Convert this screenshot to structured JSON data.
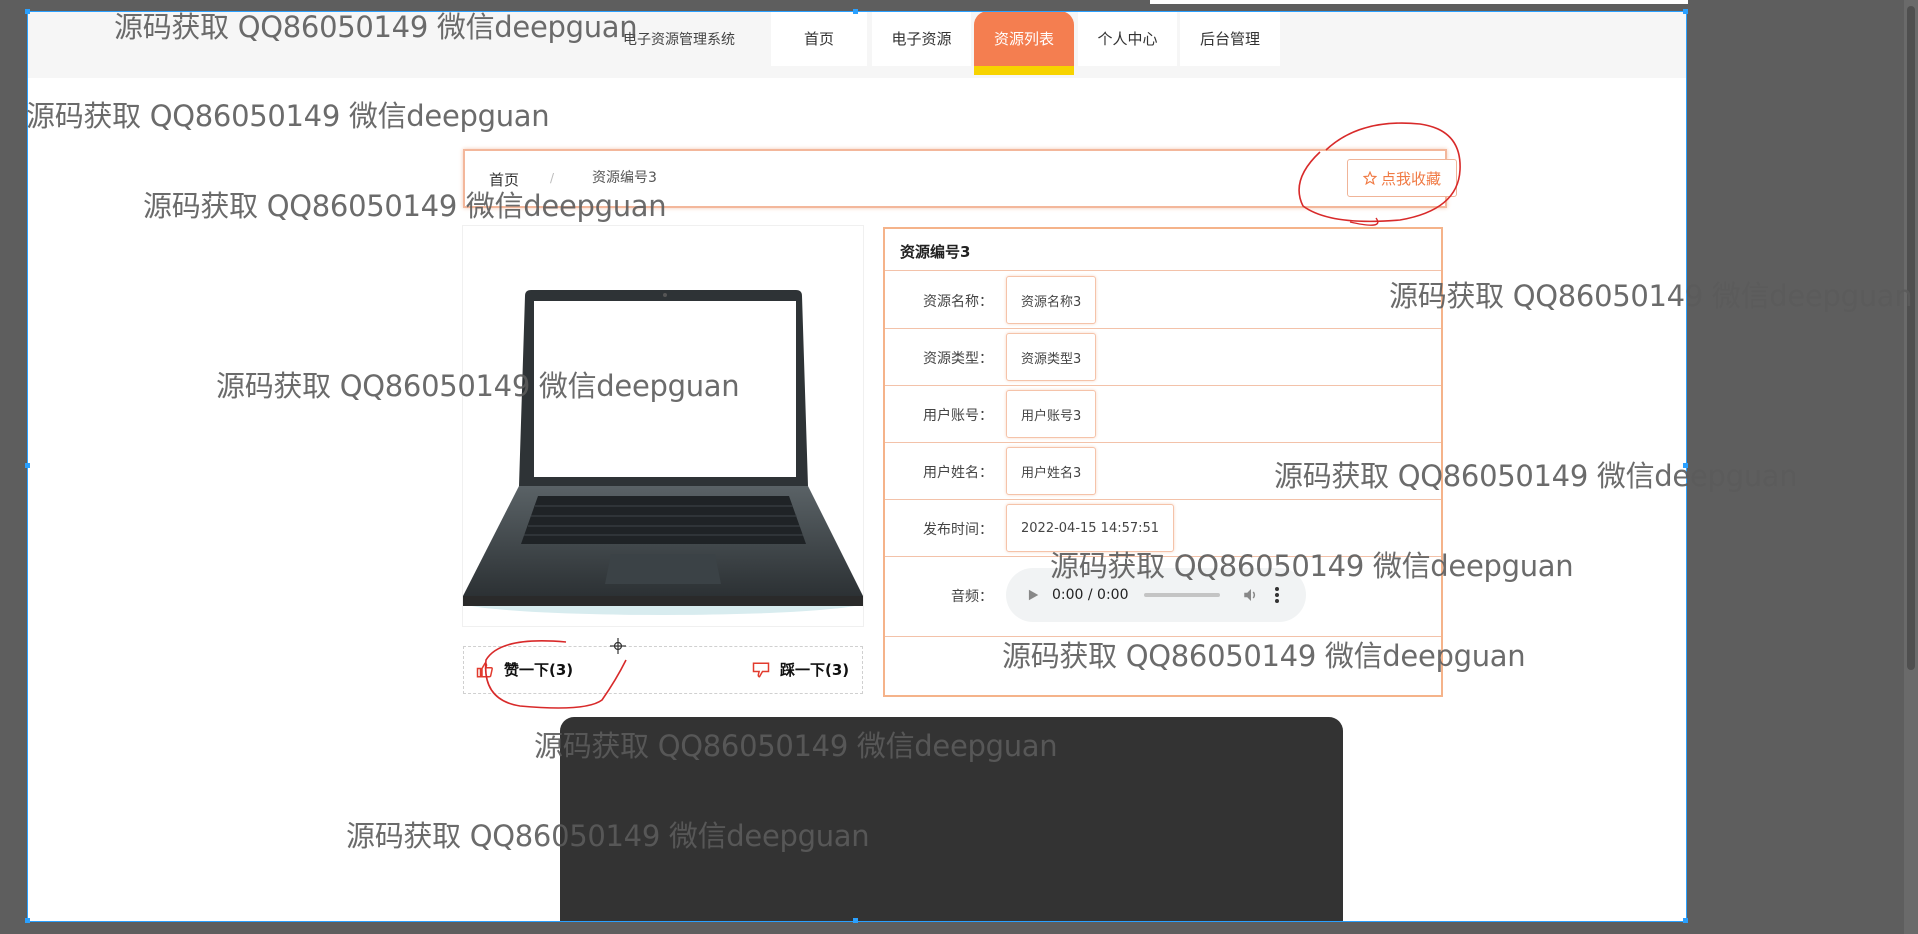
{
  "nav": {
    "brand": "电子资源管理系统",
    "items": [
      {
        "label": "首页"
      },
      {
        "label": "电子资源"
      },
      {
        "label": "资源列表"
      },
      {
        "label": "个人中心"
      },
      {
        "label": "后台管理"
      }
    ],
    "active_index": 2
  },
  "breadcrumb": {
    "home": "首页",
    "separator": "/",
    "current": "资源编号3"
  },
  "favorite_button": {
    "label": "点我收藏",
    "icon": "star-outline-icon"
  },
  "product": {
    "image": "laptop-image"
  },
  "votes": {
    "like": {
      "label": "赞一下(3)",
      "icon": "thumbs-up-icon"
    },
    "dislike": {
      "label": "踩一下(3)",
      "icon": "thumbs-down-icon"
    }
  },
  "detail": {
    "title": "资源编号3",
    "rows": [
      {
        "label": "资源名称：",
        "value": "资源名称3"
      },
      {
        "label": "资源类型：",
        "value": "资源类型3"
      },
      {
        "label": "用户账号：",
        "value": "用户账号3"
      },
      {
        "label": "用户姓名：",
        "value": "用户姓名3"
      },
      {
        "label": "发布时间：",
        "value": "2022-04-15 14:57:51"
      }
    ],
    "audio": {
      "label": "音频：",
      "time": "0:00 / 0:00"
    }
  },
  "watermark": "源码获取 QQ86050149 微信deepguan",
  "colors": {
    "accent": "#f47e50",
    "active_underline": "#f7d300",
    "border": "#f5b38a",
    "selection": "#2aa0ff"
  }
}
